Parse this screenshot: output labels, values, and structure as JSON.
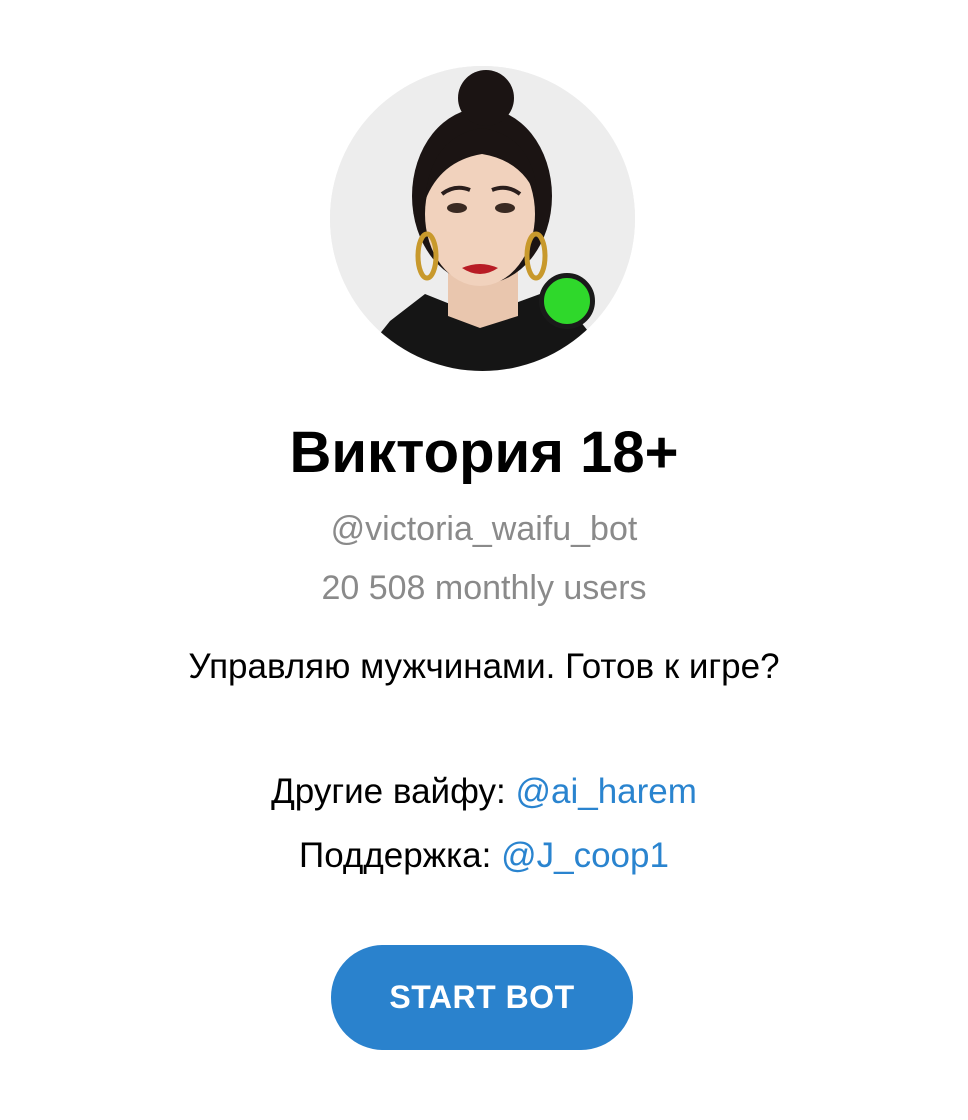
{
  "profile": {
    "name": "Виктория 18+",
    "username": "@victoria_waifu_bot",
    "monthly_users": "20 508 monthly users",
    "description": "Управляю мужчинами. Готов к игре?",
    "others_label": "Другие вайфу: ",
    "others_link": "@ai_harem",
    "support_label": "Поддержка: ",
    "support_link": "@J_coop1",
    "online_status_color": "#2fd82b"
  },
  "actions": {
    "start_label": "START BOT"
  },
  "colors": {
    "accent": "#2a82cd",
    "link": "#2a84cf",
    "muted_text": "#8a8a8a"
  }
}
